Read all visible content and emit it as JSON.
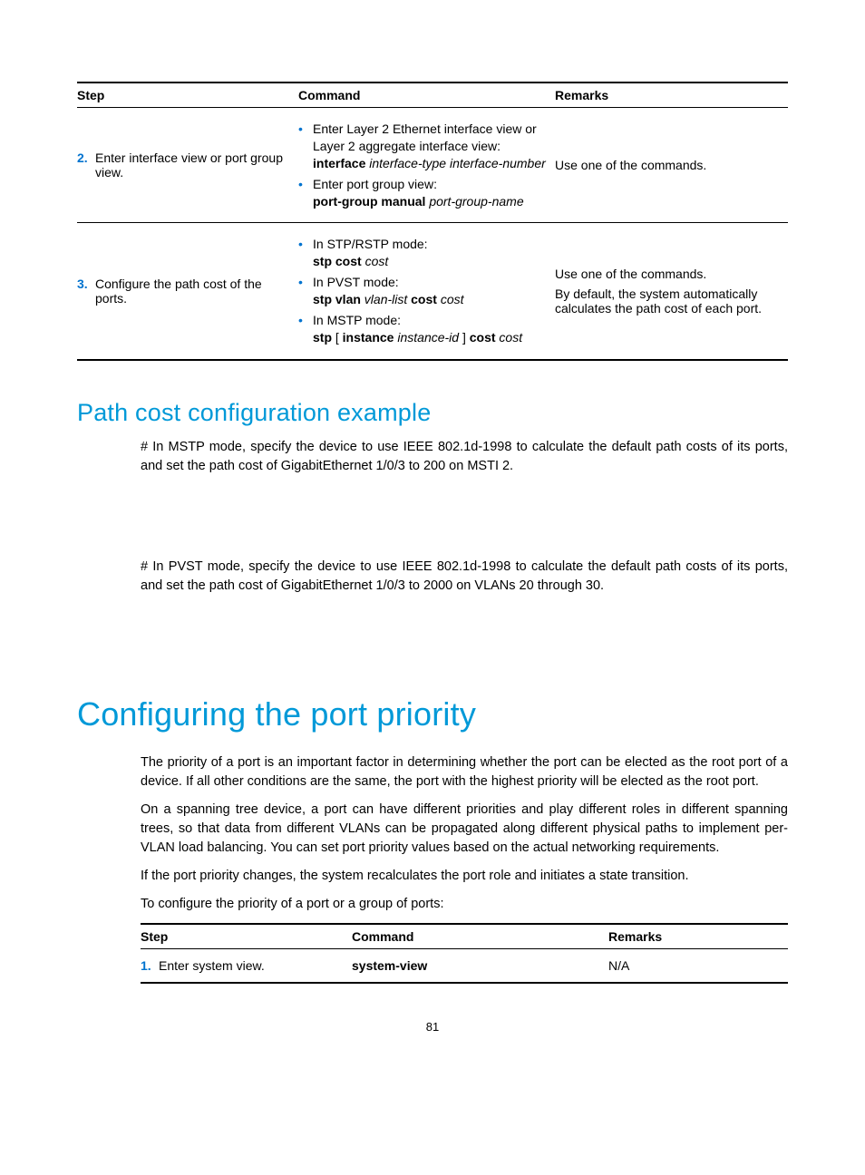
{
  "table1": {
    "headers": {
      "step": "Step",
      "command": "Command",
      "remarks": "Remarks"
    },
    "rows": [
      {
        "num": "2.",
        "step": "Enter interface view or port group view.",
        "bullets": [
          {
            "lead": "Enter Layer 2 Ethernet interface view or Layer 2 aggregate interface view:",
            "bold1": "interface",
            "ital1": " interface-type interface-number"
          },
          {
            "lead": "Enter port group view:",
            "bold1": "port-group manual",
            "ital1": " port-group-name"
          }
        ],
        "remarks": "Use one of the commands."
      },
      {
        "num": "3.",
        "step": "Configure the path cost of the ports.",
        "bullets": [
          {
            "lead": "In STP/RSTP mode:",
            "bold1": "stp cost",
            "ital1": " cost"
          },
          {
            "lead": "In PVST mode:",
            "bold1": "stp vlan",
            "ital1": " vlan-list ",
            "bold2": "cost",
            "ital2": " cost"
          },
          {
            "lead": "In MSTP mode:",
            "bold1": "stp",
            "plain1": " [ ",
            "bold2": "instance",
            "ital1": " instance-id",
            "plain2": " ] ",
            "bold3": "cost",
            "ital2": " cost"
          }
        ],
        "remarks_multi": [
          "Use one of the commands.",
          "By default, the system automatically calculates the path cost of each port."
        ]
      }
    ]
  },
  "sec1_title": "Path cost configuration example",
  "para1": "# In MSTP mode, specify the device to use IEEE 802.1d-1998 to calculate the default path costs of its ports, and set the path cost of GigabitEthernet 1/0/3 to 200 on MSTI 2.",
  "para2": "# In PVST mode, specify the device to use IEEE 802.1d-1998 to calculate the default path costs of its ports, and set the path cost of GigabitEthernet 1/0/3 to 2000 on VLANs 20 through 30.",
  "sec2_title": "Configuring the port priority",
  "para3": "The priority of a port is an important factor in determining whether the port can be elected as the root port of a device. If all other conditions are the same, the port with the highest priority will be elected as the root port.",
  "para4": "On a spanning tree device, a port can have different priorities and play different roles in different spanning trees, so that data from different VLANs can be propagated along different physical paths to implement per-VLAN load balancing. You can set port priority values based on the actual networking requirements.",
  "para5": "If the port priority changes, the system recalculates the port role and initiates a state transition.",
  "para6": "To configure the priority of a port or a group of ports:",
  "table2": {
    "headers": {
      "step": "Step",
      "command": "Command",
      "remarks": "Remarks"
    },
    "row": {
      "num": "1.",
      "step": "Enter system view.",
      "cmd": "system-view",
      "remarks": "N/A"
    }
  },
  "pagenum": "81"
}
